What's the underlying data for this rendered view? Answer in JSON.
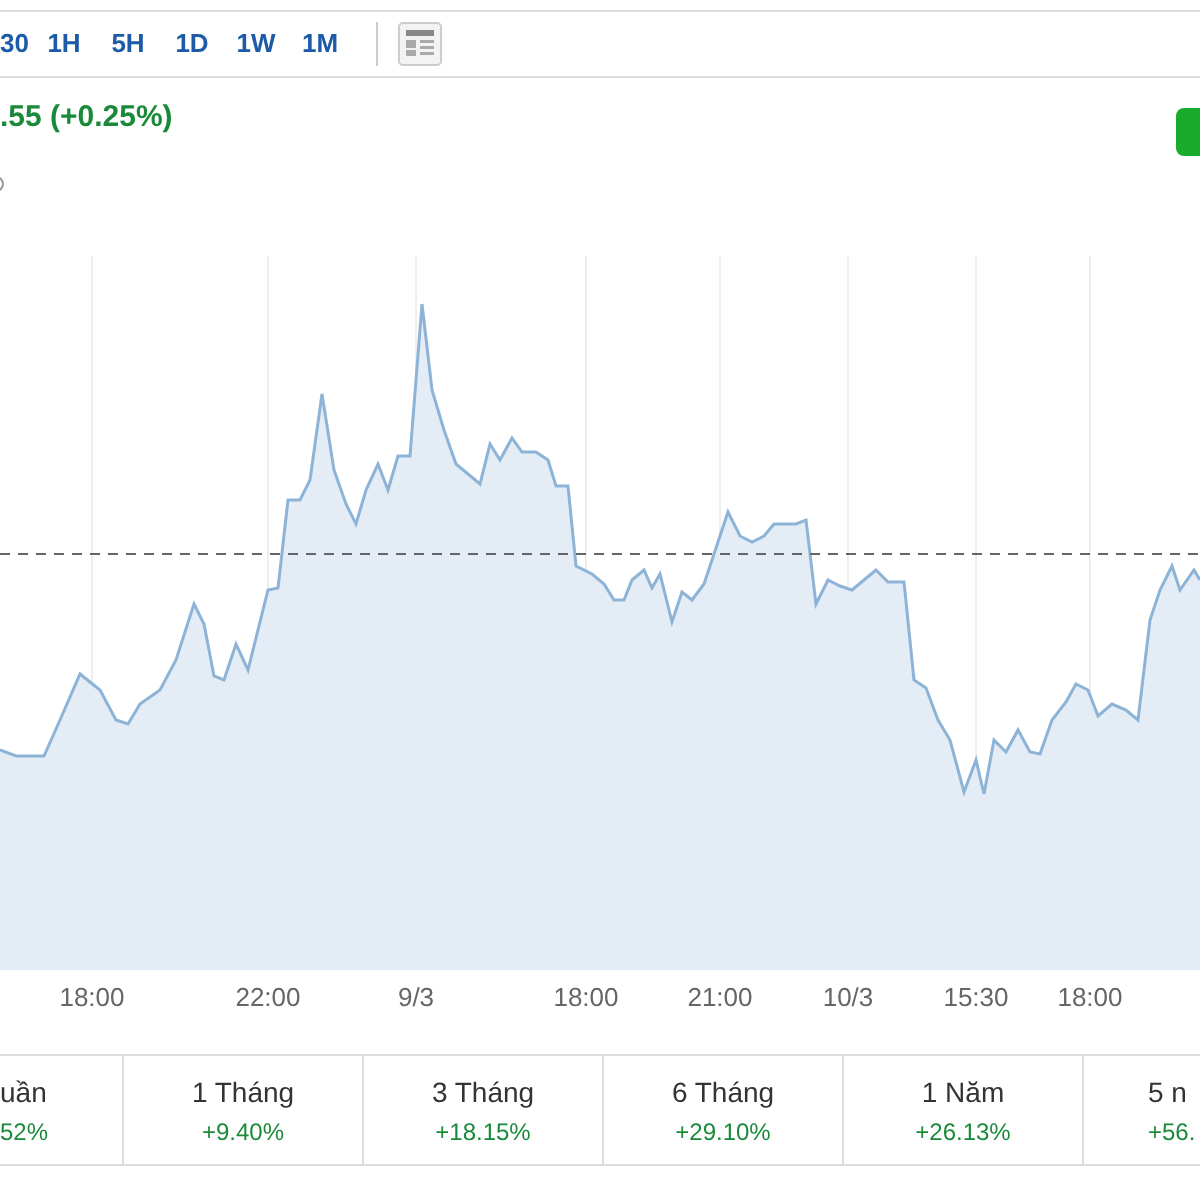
{
  "intervals": [
    {
      "label": "30",
      "selected": false
    },
    {
      "label": "1H",
      "selected": false
    },
    {
      "label": "5H",
      "selected": false
    },
    {
      "label": "1D",
      "selected": false
    },
    {
      "label": "1W",
      "selected": false
    },
    {
      "label": "1M",
      "selected": false
    }
  ],
  "change": ".55 (+0.25%)",
  "chart": {
    "x_labels": [
      "18:00",
      "22:00",
      "9/3",
      "18:00",
      "21:00",
      "10/3",
      "15:30",
      "18:00"
    ]
  },
  "performance": [
    {
      "period": "uần",
      "change": "52%"
    },
    {
      "period": "1 Tháng",
      "change": "+9.40%"
    },
    {
      "period": "3 Tháng",
      "change": "+18.15%"
    },
    {
      "period": "6 Tháng",
      "change": "+29.10%"
    },
    {
      "period": "1 Năm",
      "change": "+26.13%"
    },
    {
      "period": "5 n",
      "change": "+56."
    }
  ]
}
